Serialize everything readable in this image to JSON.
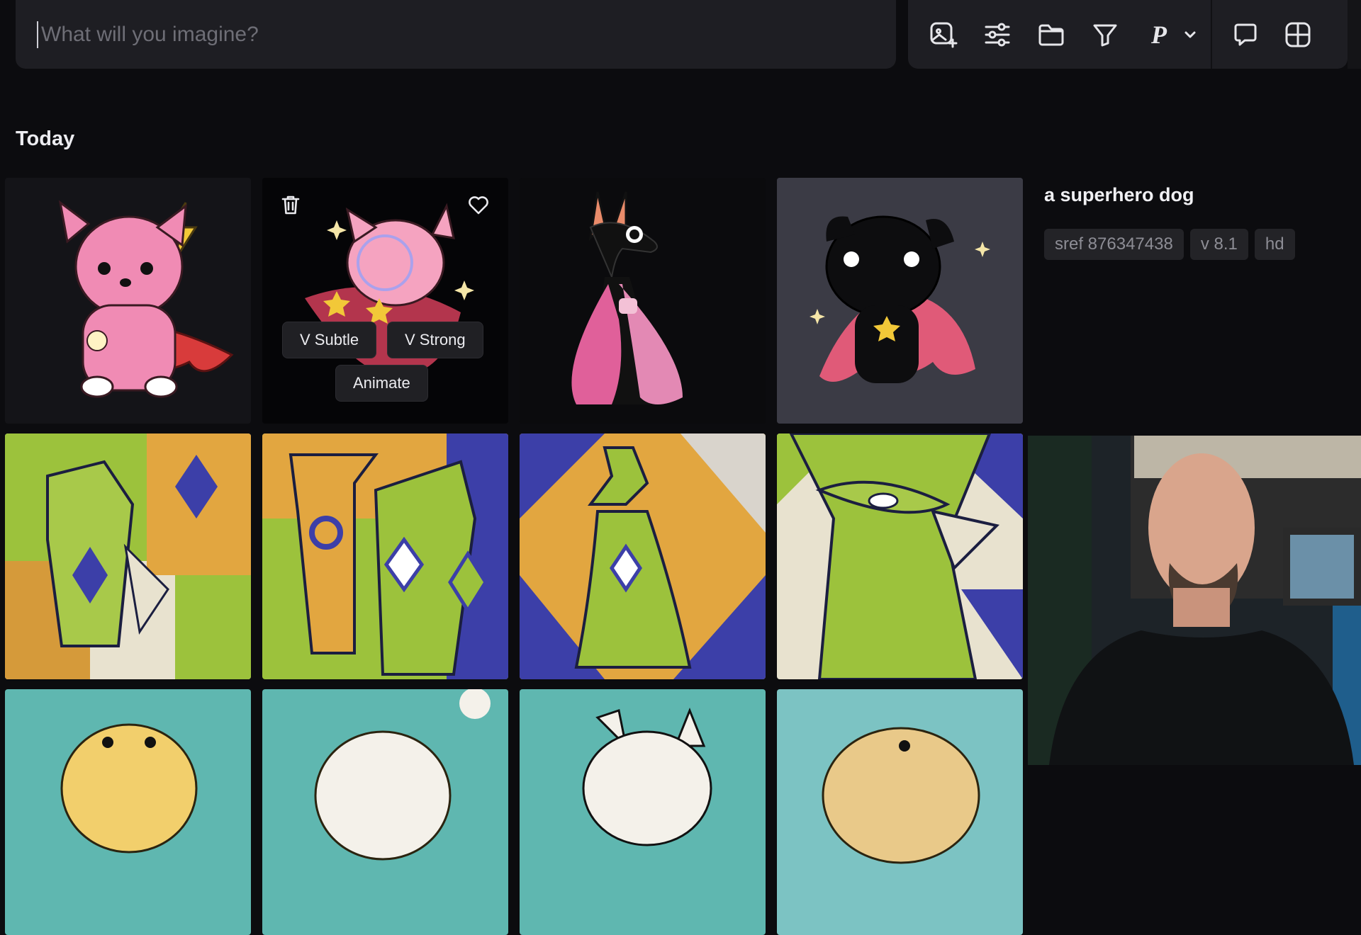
{
  "prompt": {
    "placeholder": "What will you imagine?",
    "value": ""
  },
  "toolbar": {
    "icons": [
      "image-prompt-icon",
      "settings-sliders-icon",
      "folder-icon",
      "filter-icon",
      "personalize-p-icon",
      "chevron-down-icon",
      "chat-icon",
      "grid-icon"
    ],
    "personalize_label": "P"
  },
  "section": {
    "title": "Today"
  },
  "selected_job": {
    "prompt": "a superhero dog",
    "tags": [
      "sref 876347438",
      "v 8.1",
      "hd"
    ]
  },
  "hover_actions": {
    "vary_subtle": "V Subtle",
    "vary_strong": "V Strong",
    "animate": "Animate"
  },
  "colors": {
    "background": "#0c0c0f",
    "panel": "#1e1e23",
    "tag_bg": "#232327",
    "tag_text": "#8d8d95"
  }
}
